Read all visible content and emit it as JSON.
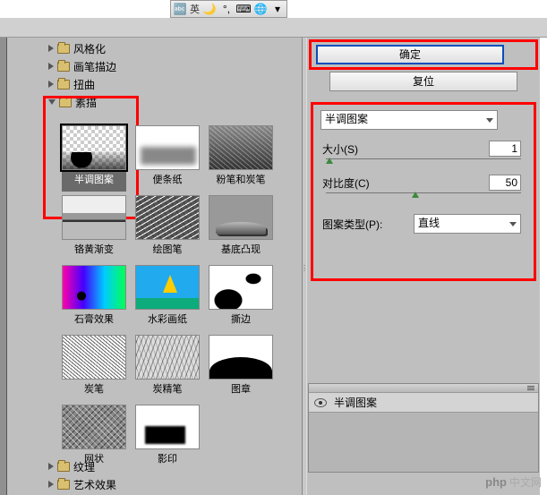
{
  "ime": {
    "lang": "英"
  },
  "tree": {
    "stylize": "风格化",
    "brush_strokes": "画笔描边",
    "distort": "扭曲",
    "sketch": "素描",
    "texture": "纹理",
    "artistic": "艺术效果"
  },
  "filters": [
    {
      "label": "半调图案",
      "selected": true
    },
    {
      "label": "便条纸"
    },
    {
      "label": "粉笔和炭笔"
    },
    {
      "label": "铬黄渐变"
    },
    {
      "label": "绘图笔"
    },
    {
      "label": "基底凸现"
    },
    {
      "label": "石膏效果"
    },
    {
      "label": "水彩画纸"
    },
    {
      "label": "撕边"
    },
    {
      "label": "炭笔"
    },
    {
      "label": "炭精笔"
    },
    {
      "label": "图章"
    },
    {
      "label": "网状"
    },
    {
      "label": "影印"
    }
  ],
  "buttons": {
    "ok": "确定",
    "reset": "复位"
  },
  "params": {
    "filter_name": "半调图案",
    "size_label": "大小(S)",
    "size_value": "1",
    "contrast_label": "对比度(C)",
    "contrast_value": "50",
    "pattern_label": "图案类型(P):",
    "pattern_value": "直线"
  },
  "layers": {
    "layer_name": "半调图案"
  },
  "watermark": {
    "php": "php",
    "cn": "中文网"
  }
}
